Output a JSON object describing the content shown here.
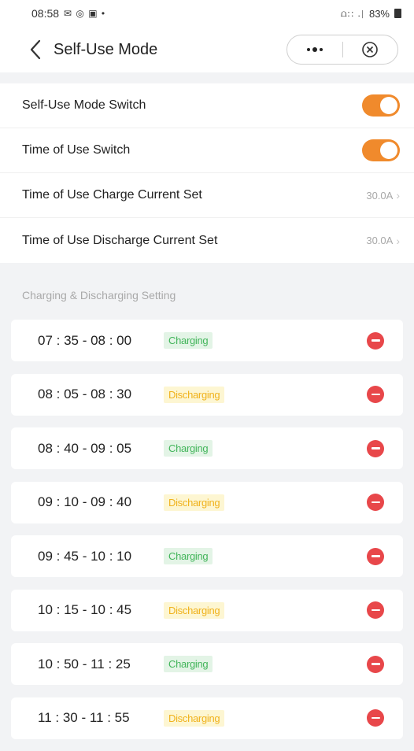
{
  "status_bar": {
    "time": "08:58",
    "notification_icons": "✉ ◎ ▣ •",
    "signal_text": "⩍∷ .∣",
    "battery_percent": "83%"
  },
  "nav": {
    "title": "Self-Use Mode",
    "back_icon": "chevron-left-icon",
    "more_icon": "more-dots-icon",
    "close_icon": "circle-close-icon"
  },
  "settings": [
    {
      "label": "Self-Use Mode Switch",
      "type": "toggle",
      "on": true
    },
    {
      "label": "Time of Use Switch",
      "type": "toggle",
      "on": true
    },
    {
      "label": "Time of Use Charge Current Set",
      "type": "value",
      "value": "30.0A"
    },
    {
      "label": "Time of Use Discharge Current Set",
      "type": "value",
      "value": "30.0A"
    }
  ],
  "section_title": "Charging & Discharging Setting",
  "schedule": [
    {
      "time": "07 : 35 - 08 : 00",
      "mode": "Charging"
    },
    {
      "time": "08 : 05 - 08 : 30",
      "mode": "Discharging"
    },
    {
      "time": "08 : 40 - 09 : 05",
      "mode": "Charging"
    },
    {
      "time": "09 : 10 - 09 : 40",
      "mode": "Discharging"
    },
    {
      "time": "09 : 45 - 10 : 10",
      "mode": "Charging"
    },
    {
      "time": "10 : 15 - 10 : 45",
      "mode": "Discharging"
    },
    {
      "time": "10 : 50 - 11 : 25",
      "mode": "Charging"
    },
    {
      "time": "11 : 30 - 11 : 55",
      "mode": "Discharging"
    }
  ],
  "colors": {
    "toggle_on": "#f08a2c",
    "charging_text": "#43b55b",
    "charging_bg": "#e3f4e6",
    "discharging_text": "#f0b21c",
    "discharging_bg": "#fdf6d2",
    "remove": "#e8474a"
  }
}
